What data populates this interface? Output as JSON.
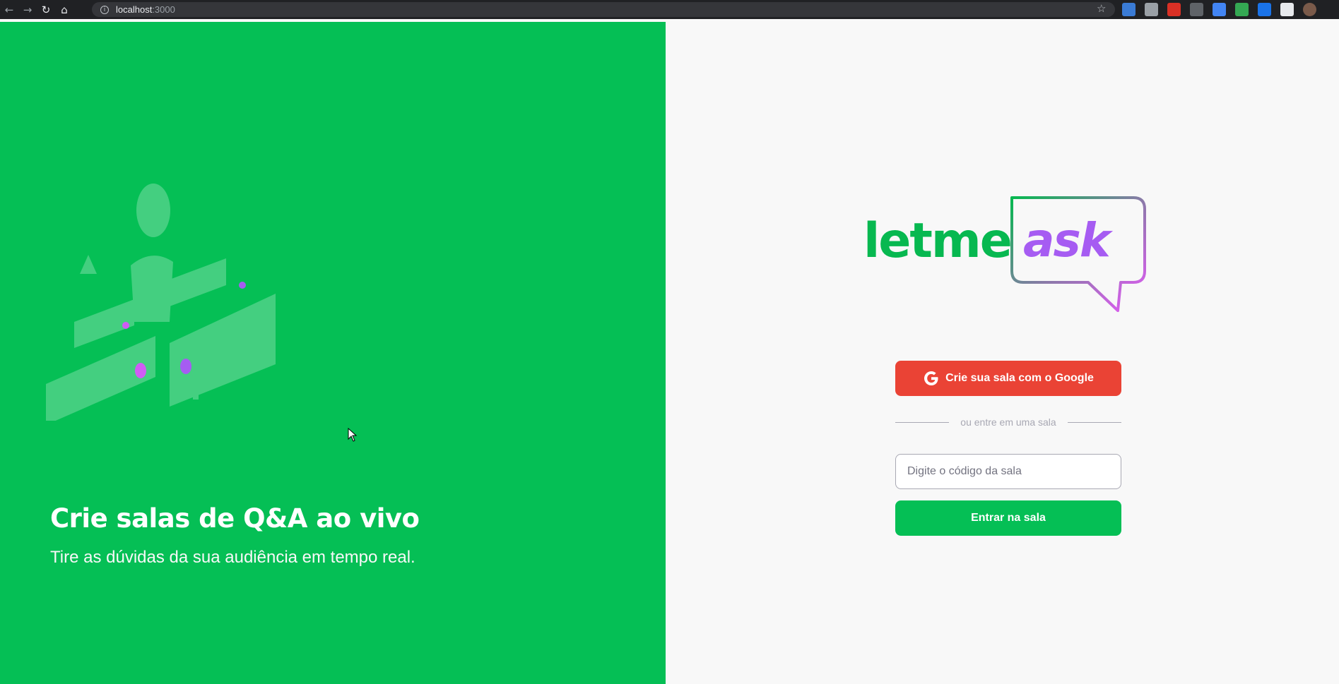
{
  "browser": {
    "url_host": "localhost",
    "url_port": ":3000",
    "icons": [
      "back-icon",
      "forward-icon",
      "reload-icon",
      "home-icon",
      "info-icon",
      "star-icon"
    ],
    "extensions": [
      {
        "name": "extension-s-icon",
        "color": "#3a7bd5"
      },
      {
        "name": "extension-hand-icon",
        "color": "#9aa0a6"
      },
      {
        "name": "extension-red-icon",
        "color": "#d93025"
      },
      {
        "name": "extension-grey-icon",
        "color": "#5f6368"
      },
      {
        "name": "extension-photos-icon",
        "color": "#4285f4"
      },
      {
        "name": "extension-green-icon",
        "color": "#34a853"
      },
      {
        "name": "extension-blue-icon",
        "color": "#1a73e8"
      },
      {
        "name": "extensions-puzzle-icon",
        "color": "#e8eaed"
      },
      {
        "name": "profile-avatar",
        "color": "#7a5a4a"
      }
    ]
  },
  "hero": {
    "title": "Crie salas de Q&A ao vivo",
    "subtitle": "Tire as dúvidas da sua audiência em tempo real."
  },
  "logo": {
    "part1": "letme",
    "part2": "ask"
  },
  "actions": {
    "google_label": "Crie sua sala com o Google",
    "separator_text": "ou entre em uma sala",
    "room_placeholder": "Digite o código da sala",
    "room_value": "",
    "enter_label": "Entrar na sala"
  },
  "colors": {
    "brand_green": "#05bf55",
    "google_red": "#ea4335",
    "logo_purple": "#a65cf2",
    "logo_pink": "#e559f9",
    "background": "#f8f8f8"
  }
}
